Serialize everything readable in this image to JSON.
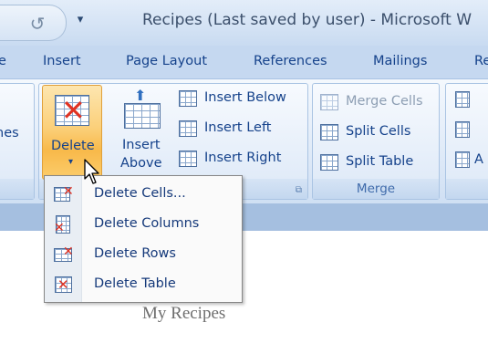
{
  "window": {
    "title": "Recipes (Last saved by user) - Microsoft W"
  },
  "tabs": [
    {
      "label": "e"
    },
    {
      "label": "Insert"
    },
    {
      "label": "Page Layout"
    },
    {
      "label": "References"
    },
    {
      "label": "Mailings"
    },
    {
      "label": "Re"
    }
  ],
  "ribbon": {
    "partial_left_label": "nes",
    "delete_button": {
      "label": "Delete"
    },
    "insert_above": {
      "line1": "Insert",
      "line2": "Above"
    },
    "insert_below": {
      "label": "Insert Below"
    },
    "insert_left": {
      "label": "Insert Left"
    },
    "insert_right": {
      "label": "Insert Right"
    },
    "merge_group": {
      "label": "Merge",
      "merge_cells": "Merge Cells",
      "split_cells": "Split Cells",
      "split_table": "Split Table"
    },
    "partial_right_label": "A"
  },
  "delete_menu": {
    "items": [
      {
        "label": "Delete Cells...",
        "icon": "delete-cells-icon"
      },
      {
        "label": "Delete Columns",
        "icon": "delete-columns-icon"
      },
      {
        "label": "Delete Rows",
        "icon": "delete-rows-icon"
      },
      {
        "label": "Delete Table",
        "icon": "delete-table-icon"
      }
    ]
  },
  "document": {
    "heading": "My Recipes"
  },
  "colors": {
    "ribbon_text": "#15428b",
    "pressed_button": "#f8b94a",
    "delete_red": "#e03222"
  }
}
